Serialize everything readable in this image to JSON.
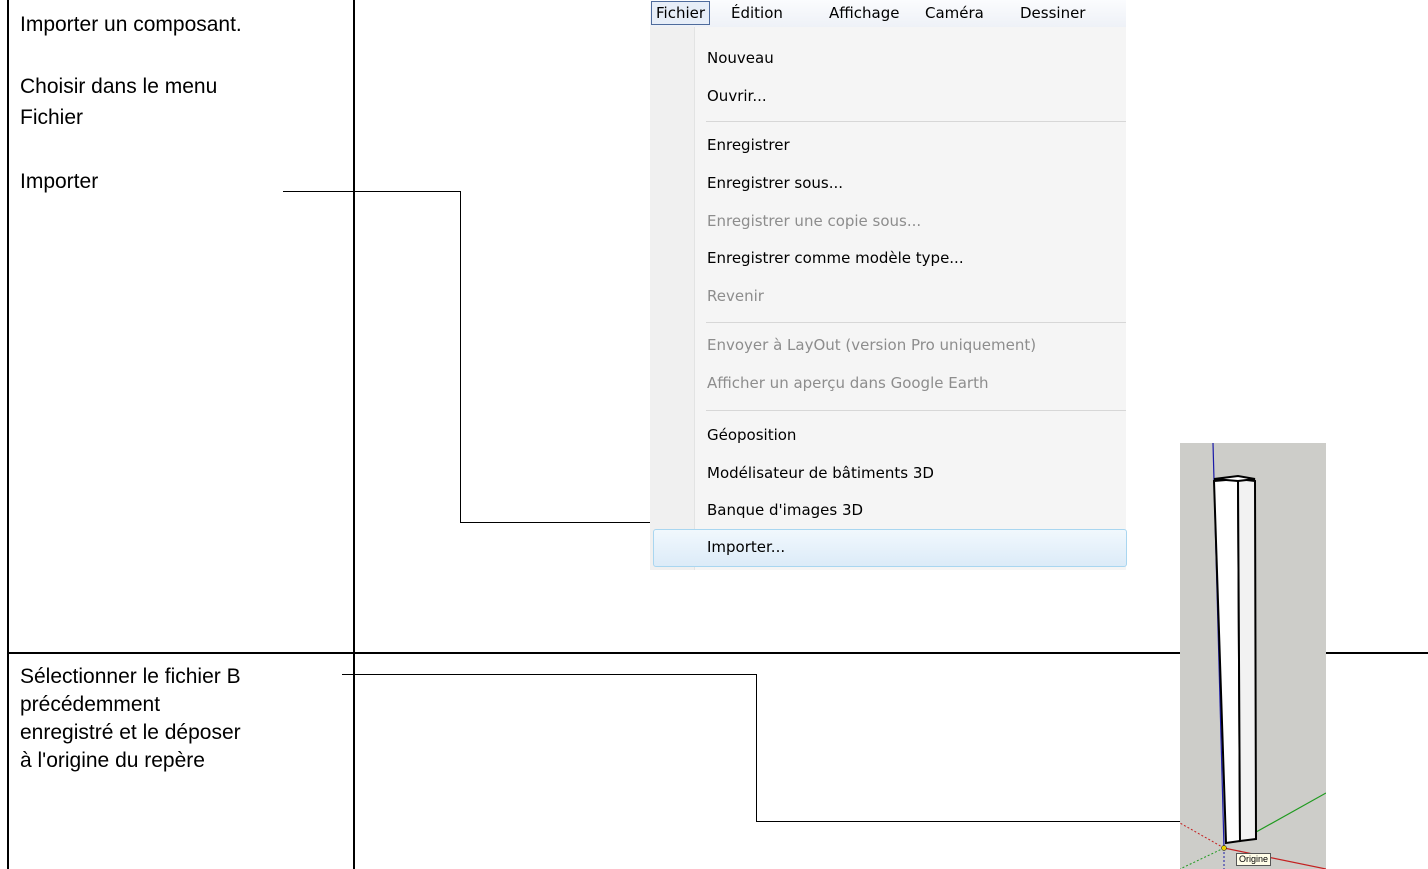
{
  "rows": [
    {
      "lines": [
        "Importer un composant.",
        "Choisir dans le menu",
        "Fichier",
        "Importer"
      ]
    },
    {
      "lines": [
        "Sélectionner le fichier B",
        "précédemment",
        "enregistré et le déposer",
        "à l'origine du repère"
      ]
    }
  ],
  "menu": {
    "bar": [
      "Fichier",
      "Édition",
      "Affichage",
      "Caméra",
      "Dessiner"
    ],
    "items": [
      {
        "label": "Nouveau",
        "enabled": true
      },
      {
        "label": "Ouvrir...",
        "enabled": true
      },
      {
        "label": "Enregistrer",
        "enabled": true
      },
      {
        "label": "Enregistrer sous...",
        "enabled": true
      },
      {
        "label": "Enregistrer une copie sous...",
        "enabled": false
      },
      {
        "label": "Enregistrer comme modèle type...",
        "enabled": true
      },
      {
        "label": "Revenir",
        "enabled": false
      },
      {
        "label": "Envoyer à LayOut (version Pro uniquement)",
        "enabled": false
      },
      {
        "label": "Afficher un aperçu dans Google Earth",
        "enabled": false
      },
      {
        "label": "Géoposition",
        "enabled": true
      },
      {
        "label": "Modélisateur de bâtiments 3D",
        "enabled": true
      },
      {
        "label": "Banque d'images 3D",
        "enabled": true
      },
      {
        "label": "Importer...",
        "enabled": true,
        "highlighted": true
      }
    ]
  },
  "viewport": {
    "origin_label": "Origine",
    "axis_colors": {
      "blue": "#1a1aa8",
      "red": "#c42020",
      "green": "#1f9a1f"
    }
  }
}
